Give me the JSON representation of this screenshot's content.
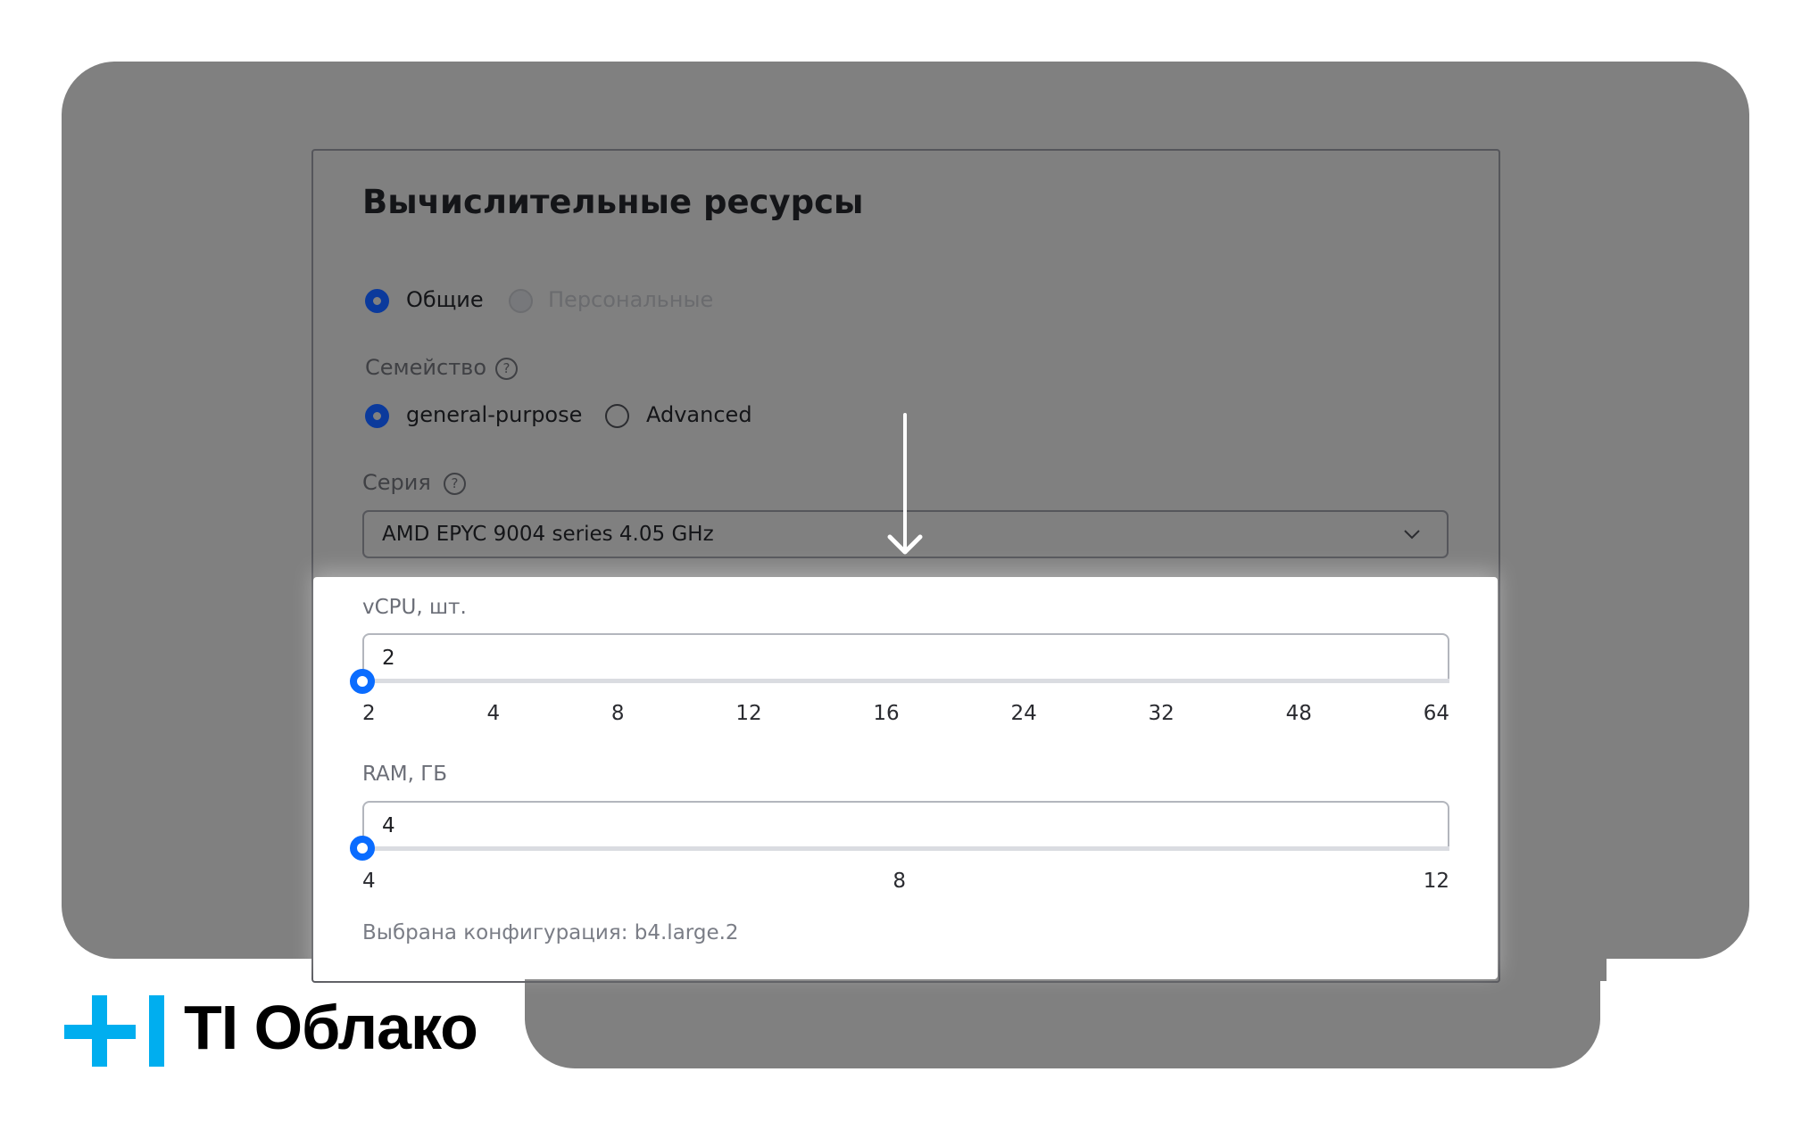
{
  "section": {
    "title": "Вычислительные ресурсы",
    "resource_type": {
      "options": [
        {
          "label": "Общие",
          "selected": true,
          "disabled": false
        },
        {
          "label": "Персональные",
          "selected": false,
          "disabled": true
        }
      ]
    },
    "family": {
      "label": "Семейство",
      "help_icon": "?",
      "options": [
        {
          "label": "general-purpose",
          "selected": true
        },
        {
          "label": "Advanced",
          "selected": false
        }
      ]
    },
    "series": {
      "label": "Серия",
      "help_icon": "?",
      "selected_value": "AMD EPYC 9004 series 4.05 GHz"
    },
    "vcpu": {
      "label": "vCPU, шт.",
      "value": "2",
      "ticks": [
        "2",
        "4",
        "8",
        "12",
        "16",
        "24",
        "32",
        "48",
        "64"
      ],
      "slider_position": 0
    },
    "ram": {
      "label": "RAM, ГБ",
      "value": "4",
      "ticks": [
        "4",
        "8",
        "12"
      ],
      "slider_position": 0
    },
    "config_text": "Выбрана конфигурация: b4.large.2"
  },
  "annotation": {
    "arrow": "down-arrow-icon"
  },
  "logo": {
    "text": "TI Облако",
    "color": "#00AEEF"
  },
  "colors": {
    "accent": "#0a6cff",
    "radio_selected": "#0b3a9c",
    "overlay_gray": "#808080"
  }
}
